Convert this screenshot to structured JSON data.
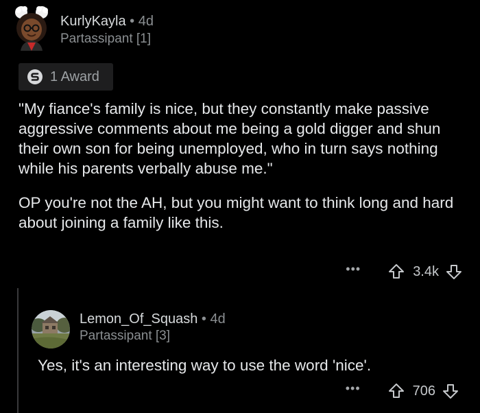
{
  "comment": {
    "author": "KurlyKayla",
    "separator": "•",
    "age": "4d",
    "flair": "Partassipant [1]",
    "award_label": "1 Award",
    "paragraphs": [
      "\"My fiance's family is nice, but they constantly make passive aggressive comments about me being a gold digger and shun their own son for being unemployed, who in turn says nothing while his parents verbally abuse me.\"",
      "OP you're not the AH, but you might want to think long and hard about joining a family like this."
    ],
    "more_label": "•••",
    "score": "3.4k",
    "upvote_icon": "arrow-up-outline",
    "downvote_icon": "arrow-down-outline"
  },
  "reply": {
    "author": "Lemon_Of_Squash",
    "separator": "•",
    "age": "4d",
    "flair": "Partassipant [3]",
    "body": "Yes, it's an interesting way to use the word 'nice'.",
    "more_label": "•••",
    "score": "706"
  },
  "colors": {
    "background": "#000000",
    "text": "#e6e8ea",
    "muted": "#8b8f92",
    "award_bg": "#1e1e1f",
    "thread_line": "#3a3a3c"
  }
}
